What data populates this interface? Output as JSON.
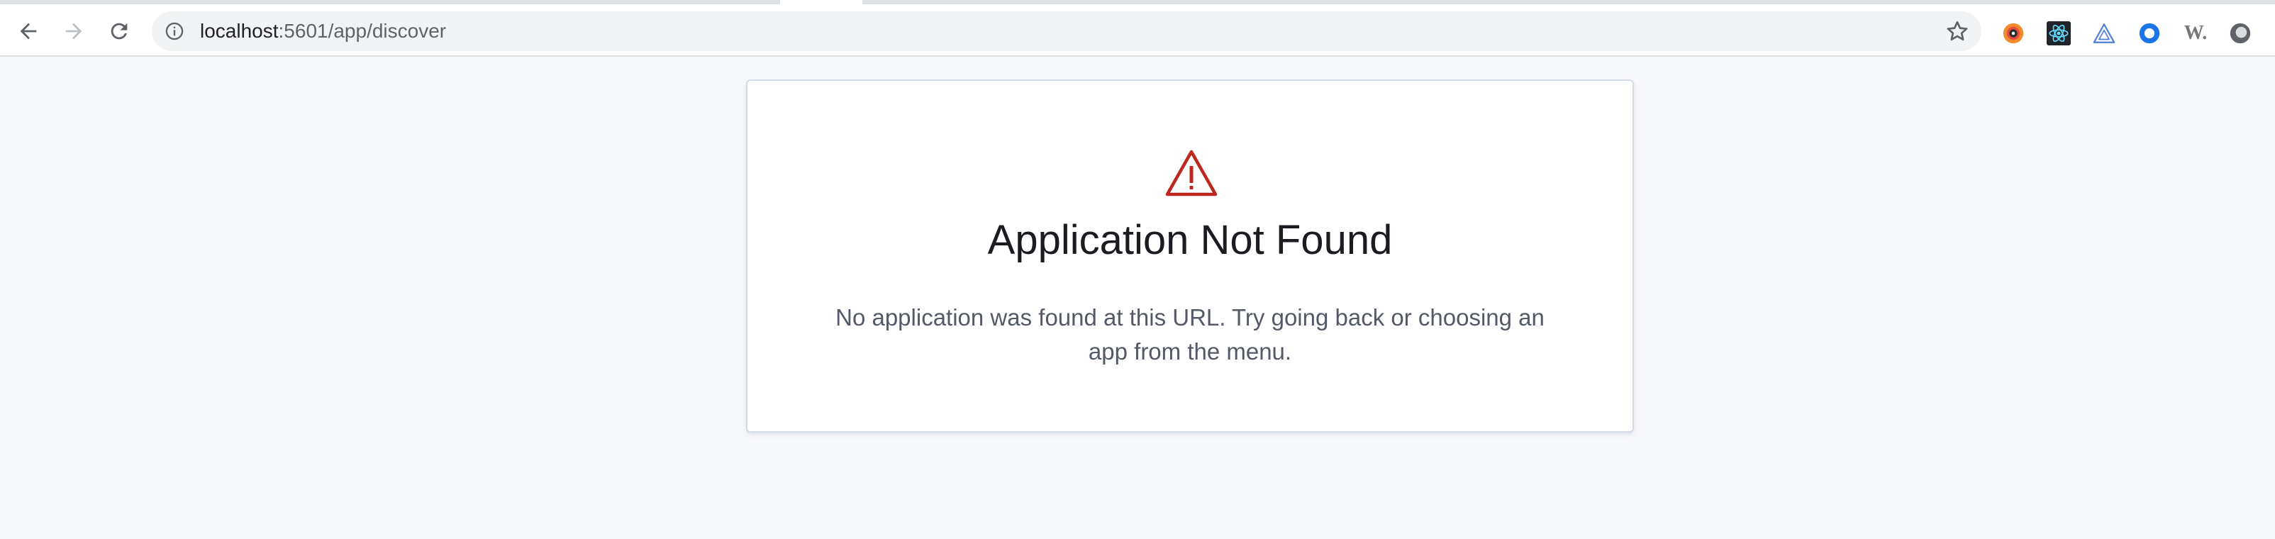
{
  "browser": {
    "url_host": "localhost",
    "url_rest": ":5601/app/discover",
    "icons": {
      "back": "arrow-left-icon",
      "forward": "arrow-right-icon",
      "reload": "reload-icon",
      "site_info": "info-icon",
      "bookmark": "star-icon"
    },
    "extensions": [
      "color-picker-extension-icon",
      "react-devtools-extension-icon",
      "triangle-extension-icon",
      "blue-circle-extension-icon",
      "w-extension-icon",
      "gray-circle-extension-icon"
    ],
    "extension_w_label": "W."
  },
  "error_panel": {
    "icon": "warning-icon",
    "icon_color": "#bd271e",
    "title": "Application Not Found",
    "message": "No application was found at this URL. Try going back or choosing an app from the menu."
  }
}
